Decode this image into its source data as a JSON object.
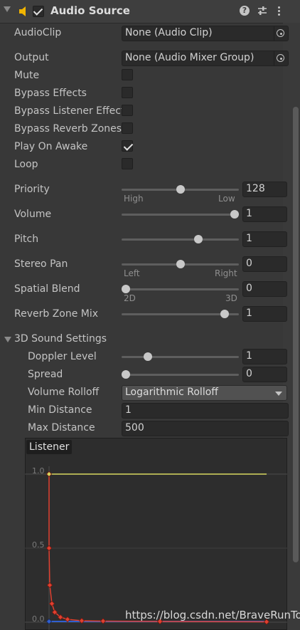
{
  "header": {
    "title": "Audio Source",
    "enabled": true,
    "help_glyph": "?"
  },
  "colors": {
    "background": "#383838",
    "speaker_icon": "#f0b400",
    "curve_volume": "#e04030",
    "curve_spatial": "#d8d860",
    "curve_spread": "#3060d0"
  },
  "fields": {
    "audioclip_label": "AudioClip",
    "audioclip_value": "None (Audio Clip)",
    "output_label": "Output",
    "output_value": "None (Audio Mixer Group)",
    "mute_label": "Mute",
    "bypass_effects_label": "Bypass Effects",
    "bypass_listener_label": "Bypass Listener Effects",
    "bypass_reverb_label": "Bypass Reverb Zones",
    "play_on_awake_label": "Play On Awake",
    "loop_label": "Loop"
  },
  "toggles": {
    "mute": false,
    "bypass_effects": false,
    "bypass_listener": false,
    "bypass_reverb": false,
    "play_on_awake": true,
    "loop": false
  },
  "sliders": {
    "priority": {
      "label": "Priority",
      "value": "128",
      "min": 0,
      "max": 256,
      "num": 128,
      "left_hint": "High",
      "right_hint": "Low"
    },
    "volume": {
      "label": "Volume",
      "value": "1",
      "min": 0,
      "max": 1,
      "num": 1
    },
    "pitch": {
      "label": "Pitch",
      "value": "1",
      "min": -3,
      "max": 3,
      "num": 1
    },
    "stereo_pan": {
      "label": "Stereo Pan",
      "value": "0",
      "min": -1,
      "max": 1,
      "num": 0,
      "left_hint": "Left",
      "right_hint": "Right"
    },
    "spatial_blend": {
      "label": "Spatial Blend",
      "value": "0",
      "min": 0,
      "max": 1,
      "num": 0,
      "left_hint": "2D",
      "right_hint": "3D"
    },
    "reverb_zone_mix": {
      "label": "Reverb Zone Mix",
      "value": "1",
      "min": 0,
      "max": 1.1,
      "num": 1
    }
  },
  "sound3d": {
    "title": "3D Sound Settings",
    "doppler": {
      "label": "Doppler Level",
      "value": "1",
      "min": 0,
      "max": 5,
      "num": 1
    },
    "spread": {
      "label": "Spread",
      "value": "0",
      "min": 0,
      "max": 360,
      "num": 0
    },
    "rolloff_label": "Volume Rolloff",
    "rolloff_value": "Logarithmic Rolloff",
    "min_distance_label": "Min Distance",
    "min_distance_value": "1",
    "max_distance_label": "Max Distance",
    "max_distance_value": "500"
  },
  "graph": {
    "listener_label": "Listener",
    "y_labels": [
      "1.0",
      "0.5",
      "0.0"
    ]
  },
  "watermark": "https://blog.csdn.net/BraveRunTo"
}
